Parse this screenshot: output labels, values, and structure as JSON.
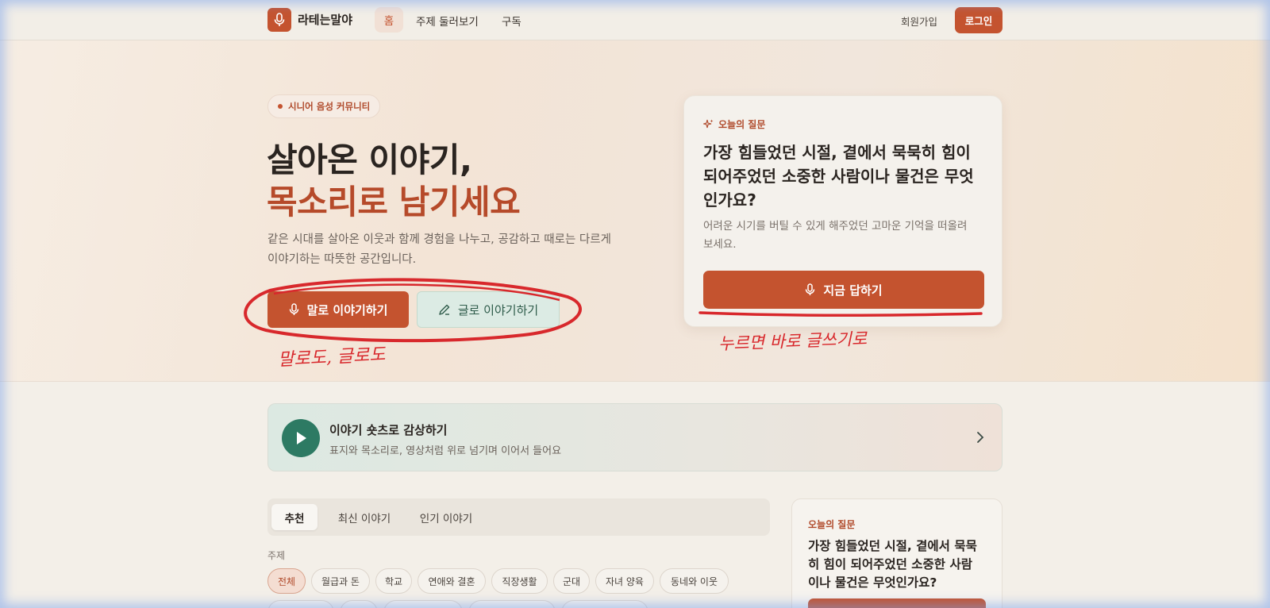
{
  "nav": {
    "logo_text": "라테는말야",
    "home": "홈",
    "browse": "주제 둘러보기",
    "subscribe": "구독",
    "signup": "회원가입",
    "login": "로그인"
  },
  "hero": {
    "badge": "시니어 음성 커뮤니티",
    "title_line1": "살아온 이야기,",
    "title_line2": "목소리로 남기세요",
    "description": "같은 시대를 살아온 이웃과 함께 경험을 나누고, 공감하고 때로는 다르게 이야기하는 따뜻한 공간입니다.",
    "voice_button": "말로 이야기하기",
    "text_button": "글로 이야기하기"
  },
  "annotations": {
    "left_note": "말로도, 글로도",
    "right_note": "누르면 바로 글쓰기로",
    "color": "#d8282c"
  },
  "question_card": {
    "label": "오늘의 질문",
    "question": "가장 힘들었던 시절, 곁에서 묵묵히 힘이 되어주었던 소중한 사람이나 물건은 무엇인가요?",
    "sub": "어려운 시기를 버틸 수 있게 해주었던 고마운 기억을 떠올려 보세요.",
    "answer_button": "지금 답하기"
  },
  "shorts": {
    "title": "이야기 숏츠로 감상하기",
    "subtitle": "표지와 목소리로, 영상처럼 위로 넘기며 이어서 들어요"
  },
  "tabs": [
    "추천",
    "최신 이야기",
    "인기 이야기"
  ],
  "topics": {
    "label": "주제",
    "chips": [
      "전체",
      "월급과 돈",
      "학교",
      "연애와 결혼",
      "직장생활",
      "군대",
      "자녀 양육",
      "동네와 이웃"
    ]
  },
  "side_card": {
    "label": "오늘의 질문",
    "question": "가장 힘들었던 시절, 곁에서 묵묵히 힘이 되어주었던 소중한 사람이나 물건은 무엇인가요?"
  },
  "colors": {
    "accent": "#c4532f",
    "green": "#2d7a63",
    "background": "#f3efe8"
  }
}
